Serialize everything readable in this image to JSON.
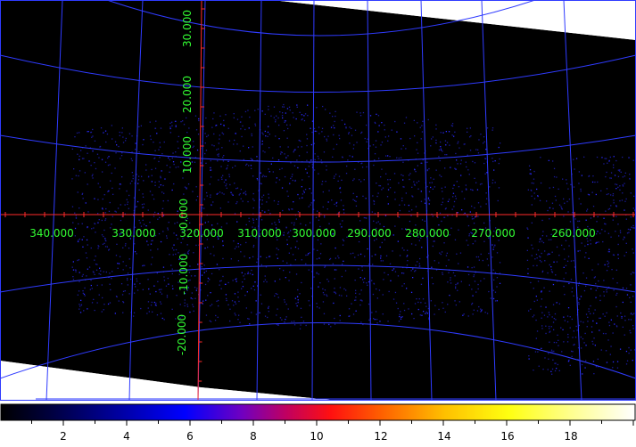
{
  "image": {
    "ra_labels": [
      "340.000",
      "330.000",
      "320.000",
      "310.000",
      "300.000",
      "290.000",
      "280.000",
      "270.000",
      "260.000"
    ],
    "dec_labels": [
      "30.000",
      "20.000",
      "10.000",
      "0.000",
      "-10.000",
      "-20.000"
    ],
    "colors": {
      "background_sky": "#000000",
      "outside_area": "#ffffff",
      "grid": "#2f3bff",
      "crosshair": "#ff2a2a",
      "labels": "#33ff33",
      "sources": "#1d1dd0"
    }
  },
  "colorbar": {
    "ticks": [
      "2",
      "4",
      "6",
      "8",
      "10",
      "12",
      "14",
      "16",
      "18"
    ],
    "range": [
      0,
      20
    ],
    "colormap": [
      "#000000",
      "#000060",
      "#0000ff",
      "#8000b0",
      "#ff0030",
      "#ff6000",
      "#ffd000",
      "#ffff40",
      "#ffffff"
    ]
  }
}
